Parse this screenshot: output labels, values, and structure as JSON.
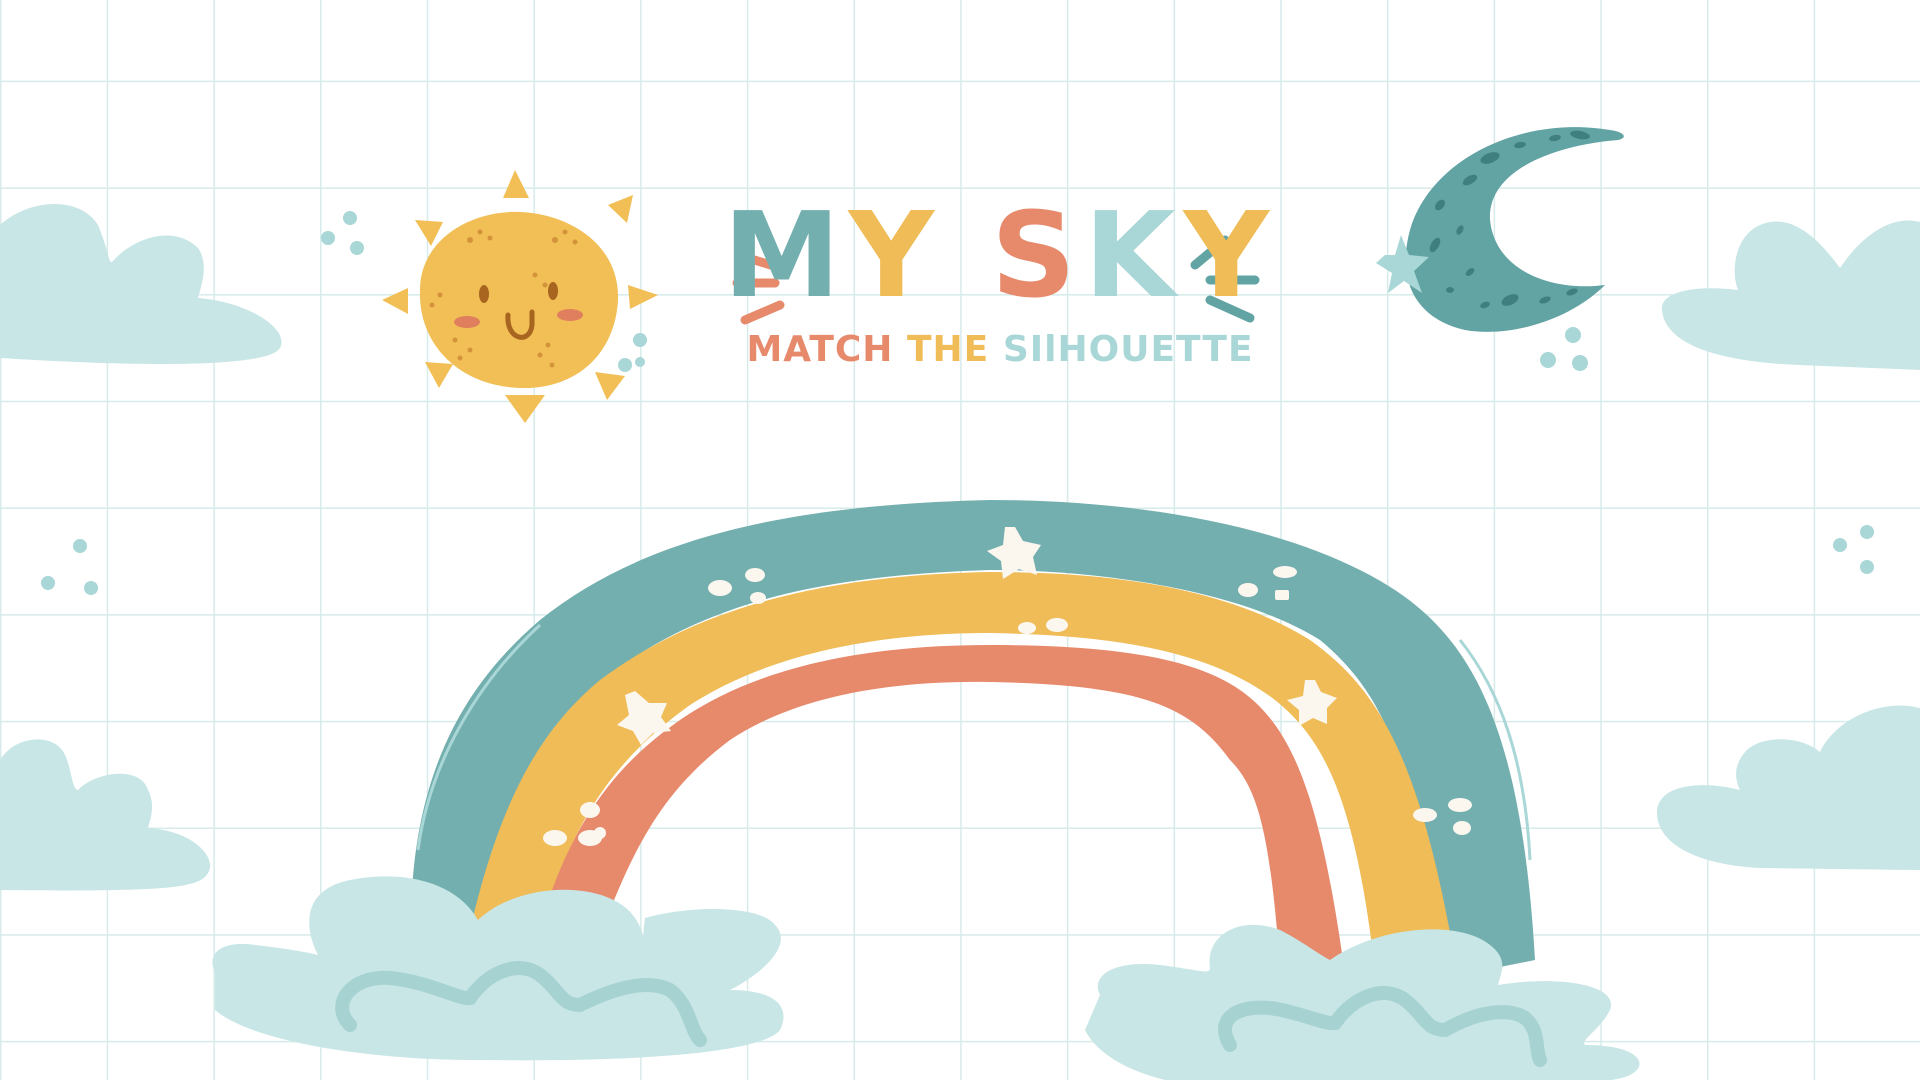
{
  "title": {
    "letters": [
      {
        "char": "M",
        "color": "#74afaf"
      },
      {
        "char": "Y",
        "color": "#efbc57"
      },
      {
        "char": " ",
        "color": "#ffffff"
      },
      {
        "char": "S",
        "color": "#e78a6c"
      },
      {
        "char": "K",
        "color": "#a9d6d6"
      },
      {
        "char": "Y",
        "color": "#efbc57"
      }
    ]
  },
  "subtitle": {
    "words": [
      {
        "text": "MATCH",
        "color": "#e78a6c"
      },
      {
        "text": "THE",
        "color": "#efbc57"
      },
      {
        "text": "SIlHOUETTE",
        "color": "#a9d6d6"
      }
    ]
  },
  "colors": {
    "grid": "#d6ebea",
    "cloud": "#c8e6e6",
    "cloud_dark": "#a7d2d2",
    "rainbow_outer": "#74afaf",
    "rainbow_middle": "#efbc57",
    "rainbow_inner": "#e78a6c",
    "sun": "#f1bf56",
    "moon": "#62a3a4"
  },
  "icons": [
    "sun-icon",
    "moon-icon",
    "star-icon",
    "rainbow-icon",
    "cloud-icon",
    "sparkle-icon"
  ]
}
